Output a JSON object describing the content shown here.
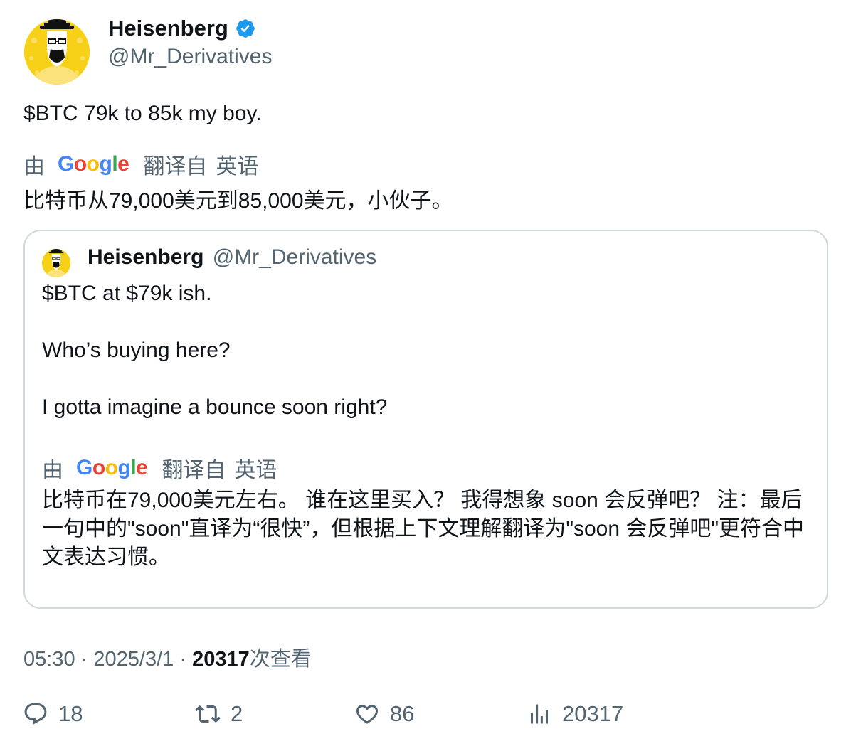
{
  "author": {
    "display_name": "Heisenberg",
    "handle": "@Mr_Derivatives",
    "verified": true
  },
  "tweet": {
    "text": "$BTC 79k to 85k my boy.",
    "translate": {
      "by": "由",
      "provider": "Google",
      "translated_from": "翻译自",
      "language": "英语"
    },
    "translation": "比特币从79,000美元到85,000美元，小伙子。"
  },
  "quote": {
    "display_name": "Heisenberg",
    "handle": "@Mr_Derivatives",
    "lines": [
      "$BTC at $79k ish.",
      "Who’s buying here?",
      "I gotta imagine a bounce soon right?"
    ],
    "translate": {
      "by": "由",
      "provider": "Google",
      "translated_from": "翻译自",
      "language": "英语"
    },
    "translation": "比特币在79,000美元左右。 谁在这里买入？ 我得想象 soon 会反弹吧？ 注：最后一句中的\"soon\"直译为“很快”，但根据上下文理解翻译为\"soon 会反弹吧\"更符合中文表达习惯。"
  },
  "meta": {
    "time": "05:30",
    "sep1": "·",
    "date": "2025/3/1",
    "sep2": "·",
    "views_count": "20317",
    "views_label": "次查看"
  },
  "actions": {
    "replies": "18",
    "reposts": "2",
    "likes": "86",
    "views": "20317"
  },
  "colors": {
    "verified": "#1d9bf0",
    "secondary_text": "#536471",
    "avatar_bg": "#f7d117"
  }
}
